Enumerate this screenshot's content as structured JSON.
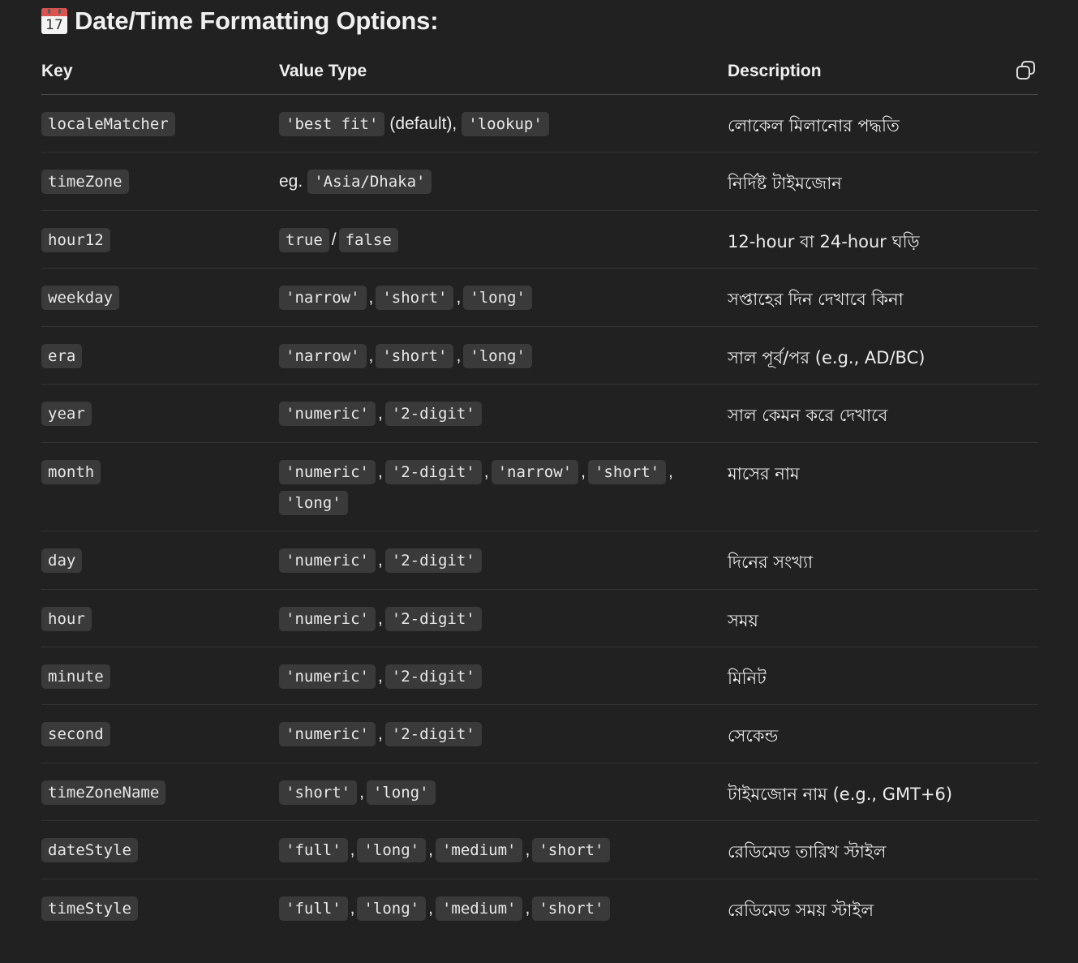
{
  "heading": {
    "icon_day": "17",
    "title": "Date/Time Formatting Options:"
  },
  "table": {
    "headers": {
      "key": "Key",
      "value_type": "Value Type",
      "description": "Description"
    },
    "rows": [
      {
        "key": "localeMatcher",
        "value_parts": [
          {
            "type": "code",
            "text": "'best fit'"
          },
          {
            "type": "text_after",
            "text": "(default),"
          },
          {
            "type": "code",
            "text": "'lookup'"
          }
        ],
        "description": "লোকেল মিলানোর পদ্ধতি"
      },
      {
        "key": "timeZone",
        "value_parts": [
          {
            "type": "text",
            "text": "eg."
          },
          {
            "type": "code",
            "text": "'Asia/Dhaka'"
          }
        ],
        "description": "নির্দিষ্ট টাইমজোন"
      },
      {
        "key": "hour12",
        "value_parts": [
          {
            "type": "code",
            "text": "true"
          },
          {
            "type": "sep",
            "text": "/"
          },
          {
            "type": "code",
            "text": "false"
          }
        ],
        "description": "12-hour বা 24-hour ঘড়ি"
      },
      {
        "key": "weekday",
        "value_parts": [
          {
            "type": "code",
            "text": "'narrow'"
          },
          {
            "type": "sep",
            "text": ","
          },
          {
            "type": "code",
            "text": "'short'"
          },
          {
            "type": "sep",
            "text": ","
          },
          {
            "type": "code",
            "text": "'long'"
          }
        ],
        "description": "সপ্তাহের দিন দেখাবে কিনা"
      },
      {
        "key": "era",
        "value_parts": [
          {
            "type": "code",
            "text": "'narrow'"
          },
          {
            "type": "sep",
            "text": ","
          },
          {
            "type": "code",
            "text": "'short'"
          },
          {
            "type": "sep",
            "text": ","
          },
          {
            "type": "code",
            "text": "'long'"
          }
        ],
        "description": "সাল পূর্ব/পর (e.g., AD/BC)"
      },
      {
        "key": "year",
        "value_parts": [
          {
            "type": "code",
            "text": "'numeric'"
          },
          {
            "type": "sep",
            "text": ","
          },
          {
            "type": "code",
            "text": "'2-digit'"
          }
        ],
        "description": "সাল কেমন করে দেখাবে"
      },
      {
        "key": "month",
        "value_parts": [
          {
            "type": "code",
            "text": "'numeric'"
          },
          {
            "type": "sep",
            "text": ","
          },
          {
            "type": "code",
            "text": "'2-digit'"
          },
          {
            "type": "sep",
            "text": ","
          },
          {
            "type": "code",
            "text": "'narrow'"
          },
          {
            "type": "sep",
            "text": ","
          },
          {
            "type": "code",
            "text": "'short'"
          },
          {
            "type": "sep",
            "text": ","
          },
          {
            "type": "code",
            "text": "'long'"
          }
        ],
        "description": "মাসের নাম"
      },
      {
        "key": "day",
        "value_parts": [
          {
            "type": "code",
            "text": "'numeric'"
          },
          {
            "type": "sep",
            "text": ","
          },
          {
            "type": "code",
            "text": "'2-digit'"
          }
        ],
        "description": "দিনের সংখ্যা"
      },
      {
        "key": "hour",
        "value_parts": [
          {
            "type": "code",
            "text": "'numeric'"
          },
          {
            "type": "sep",
            "text": ","
          },
          {
            "type": "code",
            "text": "'2-digit'"
          }
        ],
        "description": "সময়"
      },
      {
        "key": "minute",
        "value_parts": [
          {
            "type": "code",
            "text": "'numeric'"
          },
          {
            "type": "sep",
            "text": ","
          },
          {
            "type": "code",
            "text": "'2-digit'"
          }
        ],
        "description": "মিনিট"
      },
      {
        "key": "second",
        "value_parts": [
          {
            "type": "code",
            "text": "'numeric'"
          },
          {
            "type": "sep",
            "text": ","
          },
          {
            "type": "code",
            "text": "'2-digit'"
          }
        ],
        "description": "সেকেন্ড"
      },
      {
        "key": "timeZoneName",
        "value_parts": [
          {
            "type": "code",
            "text": "'short'"
          },
          {
            "type": "sep",
            "text": ","
          },
          {
            "type": "code",
            "text": "'long'"
          }
        ],
        "description": "টাইমজোন নাম (e.g., GMT+6)"
      },
      {
        "key": "dateStyle",
        "value_parts": [
          {
            "type": "code",
            "text": "'full'"
          },
          {
            "type": "sep",
            "text": ","
          },
          {
            "type": "code",
            "text": "'long'"
          },
          {
            "type": "sep",
            "text": ","
          },
          {
            "type": "code",
            "text": "'medium'"
          },
          {
            "type": "sep",
            "text": ","
          },
          {
            "type": "code",
            "text": "'short'"
          }
        ],
        "description": "রেডিমেড তারিখ স্টাইল"
      },
      {
        "key": "timeStyle",
        "value_parts": [
          {
            "type": "code",
            "text": "'full'"
          },
          {
            "type": "sep",
            "text": ","
          },
          {
            "type": "code",
            "text": "'long'"
          },
          {
            "type": "sep",
            "text": ","
          },
          {
            "type": "code",
            "text": "'medium'"
          },
          {
            "type": "sep",
            "text": ","
          },
          {
            "type": "code",
            "text": "'short'"
          }
        ],
        "description": "রেডিমেড সময় স্টাইল"
      }
    ]
  },
  "icons": {
    "heading": "calendar-icon",
    "copy": "copy-icon"
  },
  "colors": {
    "background": "#212121",
    "code_background": "#3a3a3a",
    "text": "#ececec",
    "divider": "#333333"
  }
}
